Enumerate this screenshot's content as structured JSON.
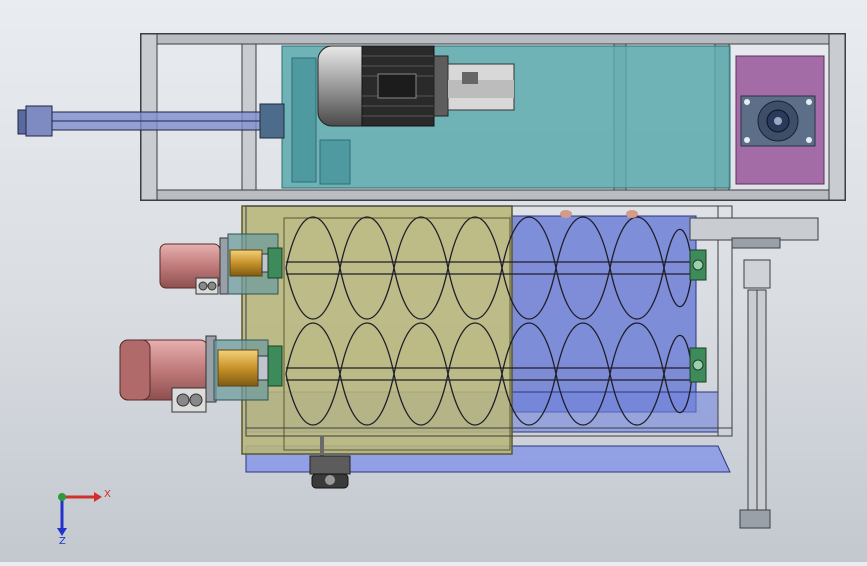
{
  "viewport": {
    "background_top": "#e9ecf0",
    "background_bottom": "#c3c8cf"
  },
  "colors": {
    "frame": "#3b3f44",
    "teal_box": "#5aa9ad",
    "magenta_box": "#a46ca7",
    "olive_hopper": "#b8b67a",
    "blue_trough": "#6f7fd6",
    "motor_red": "#c98484",
    "coupling_gold": "#d1a23a",
    "bearing_green": "#3d8a5a",
    "axis_x": "#d0312d",
    "axis_y": "#2f9a3a",
    "axis_z": "#2233cc"
  },
  "triad": {
    "x_label": "X",
    "z_label": "Z"
  },
  "icons": [
    "motor-icon",
    "gearbox-icon",
    "bearing-icon",
    "coupling-icon",
    "coordinate-triad-icon"
  ]
}
